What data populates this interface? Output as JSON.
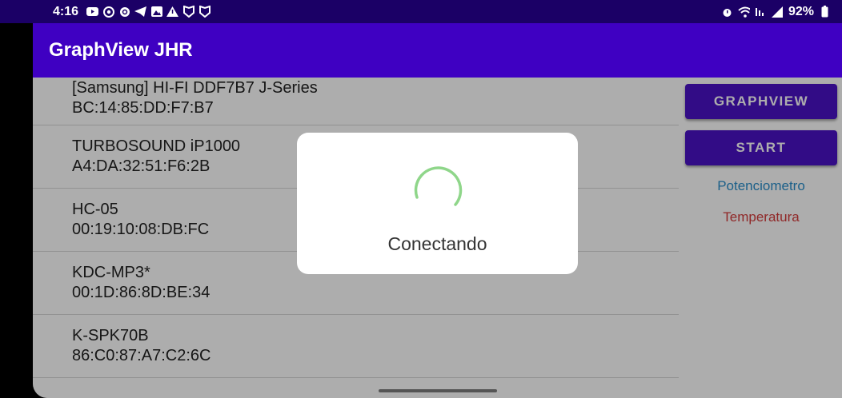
{
  "status_bar": {
    "time": "4:16",
    "left_icons": [
      "youtube-icon",
      "chrome-icon",
      "threads-icon",
      "telegram-icon",
      "gallery-icon",
      "alert-icon",
      "shield-icon",
      "shield-icon"
    ],
    "battery": "92%"
  },
  "app": {
    "title": "GraphView JHR"
  },
  "devices": [
    {
      "name": "[Samsung] HI-FI DDF7B7 J-Series",
      "address": "BC:14:85:DD:F7:B7"
    },
    {
      "name": "TURBOSOUND iP1000",
      "address": "A4:DA:32:51:F6:2B"
    },
    {
      "name": "HC-05",
      "address": "00:19:10:08:DB:FC"
    },
    {
      "name": "KDC-MP3*",
      "address": "00:1D:86:8D:BE:34"
    },
    {
      "name": "K-SPK70B",
      "address": "86:C0:87:A7:C2:6C"
    }
  ],
  "side_panel": {
    "graphview_button": "GRAPHVIEW",
    "start_button": "START",
    "potenciometro_link": "Potenciometro",
    "temperatura_link": "Temperatura"
  },
  "dialog": {
    "message": "Conectando"
  },
  "colors": {
    "status_bar": "#1b0066",
    "app_bar": "#3f00c2",
    "button": "#4b12c6",
    "potenciometro": "#2a8ecb",
    "temperatura": "#d43c3c",
    "spinner": "#8fd68a"
  }
}
